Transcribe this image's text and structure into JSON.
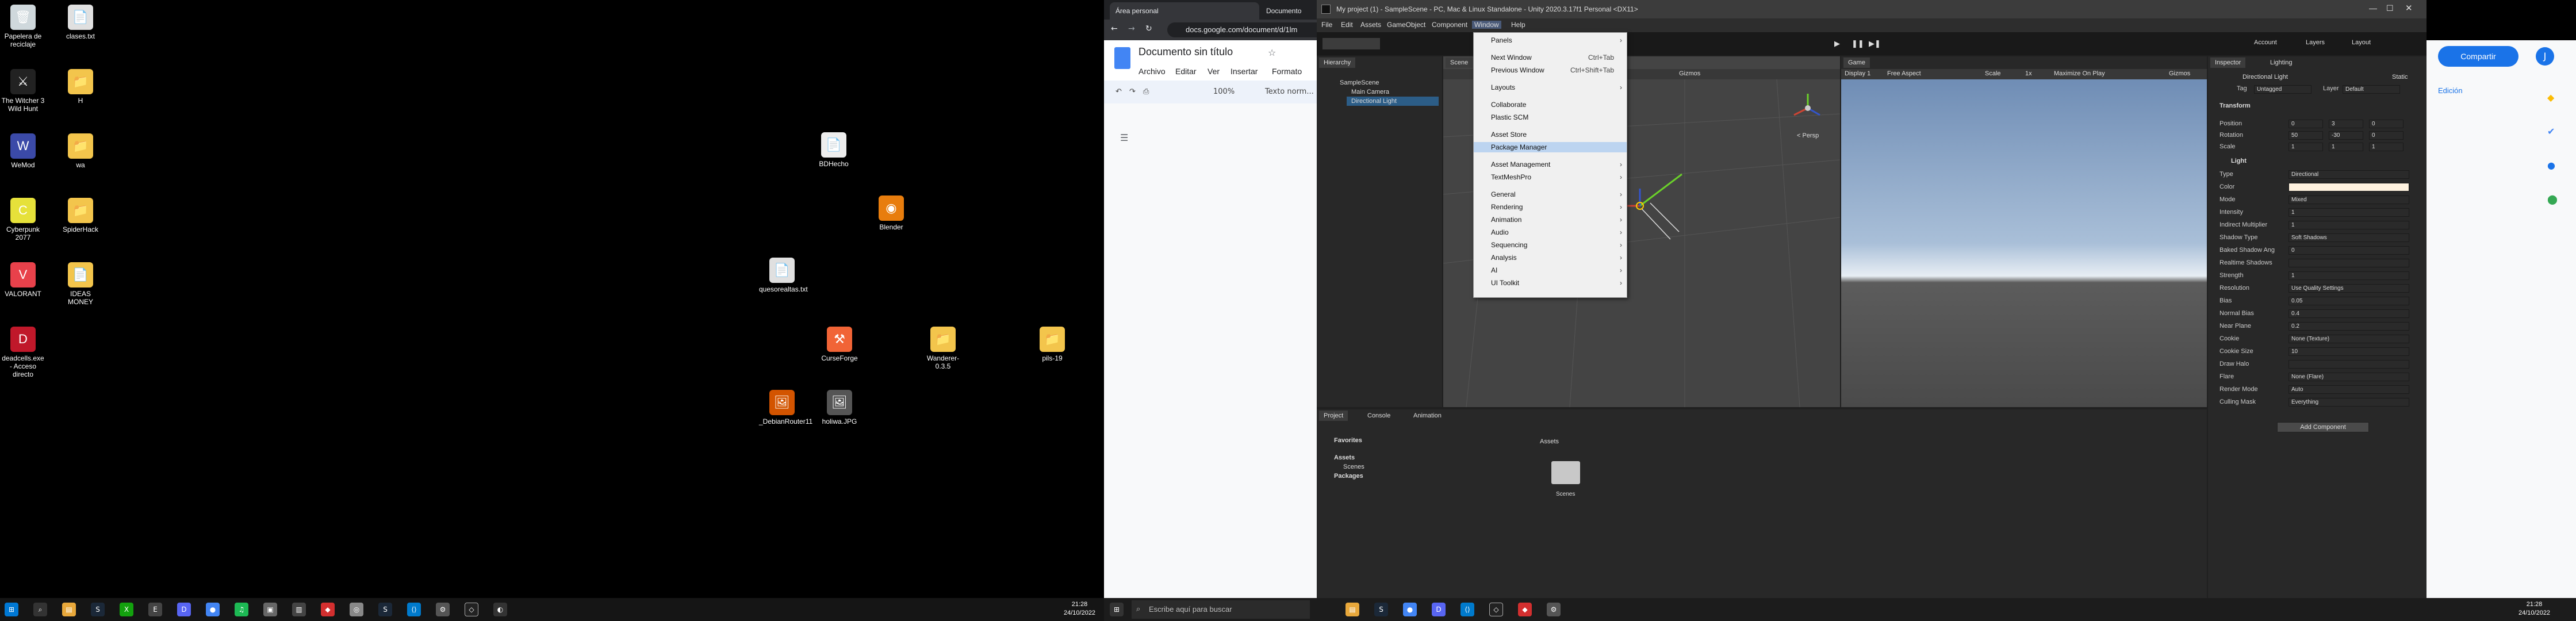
{
  "desktop": {
    "icons": [
      {
        "label": "Papelera de reciclaje",
        "icon": "recycle-bin-icon",
        "color": "#cfd8dc",
        "glyph": "🗑"
      },
      {
        "label": "clases.txt",
        "icon": "text-file-icon",
        "color": "#e0e0e0",
        "glyph": "📄"
      },
      {
        "label": "The Witcher 3 Wild Hunt",
        "icon": "witcher-icon",
        "color": "#222",
        "glyph": "⚔"
      },
      {
        "label": "H",
        "icon": "folder-icon",
        "color": "#f3c54c",
        "glyph": "📁"
      },
      {
        "label": "WeMod",
        "icon": "wemod-icon",
        "color": "#3b4aa8",
        "glyph": "W"
      },
      {
        "label": "wa",
        "icon": "folder-icon",
        "color": "#f3c54c",
        "glyph": "📁"
      },
      {
        "label": "Cyberpunk 2077",
        "icon": "cyberpunk-icon",
        "color": "#e6e13a",
        "glyph": "C"
      },
      {
        "label": "SpiderHack",
        "icon": "folder-icon",
        "color": "#f3c54c",
        "glyph": "📁"
      },
      {
        "label": "VALORANT",
        "icon": "valorant-icon",
        "color": "#e8414b",
        "glyph": "V"
      },
      {
        "label": "IDEAS MONEY",
        "icon": "text-file-icon",
        "color": "#f3c54c",
        "glyph": "📄"
      },
      {
        "label": "deadcells.exe - Acceso directo",
        "icon": "deadcells-icon",
        "color": "#c0182a",
        "glyph": "D"
      },
      {
        "label": "BDHecho",
        "icon": "document-icon",
        "color": "#eeeeee",
        "glyph": "📄"
      },
      {
        "label": "Blender",
        "icon": "blender-icon",
        "color": "#e87d0d",
        "glyph": "◉"
      },
      {
        "label": "quesorealtas.txt",
        "icon": "text-file-icon",
        "color": "#e0e0e0",
        "glyph": "📄"
      },
      {
        "label": "CurseForge",
        "icon": "curseforge-icon",
        "color": "#f16436",
        "glyph": "⚒"
      },
      {
        "label": "Wanderer-0.3.5",
        "icon": "folder-icon",
        "color": "#f3c54c",
        "glyph": "📁"
      },
      {
        "label": "pils-19",
        "icon": "folder-icon",
        "color": "#f3c54c",
        "glyph": "📁"
      },
      {
        "label": "_DebianRouter11",
        "icon": "image-icon",
        "color": "#d35400",
        "glyph": "🖼"
      },
      {
        "label": "holiwa.JPG",
        "icon": "image-icon",
        "color": "#555",
        "glyph": "🖼"
      }
    ]
  },
  "taskbar_left": {
    "time": "21:28",
    "date": "24/10/2022"
  },
  "taskbar_right": {
    "search_placeholder": "Escribe aquí para buscar",
    "time": "21:28",
    "date": "24/10/2022"
  },
  "chrome": {
    "tabs": [
      "Área personal",
      "Documento"
    ],
    "url": "docs.google.com/document/d/1lm",
    "doc_title": "Documento sin título",
    "menus": [
      "Archivo",
      "Editar",
      "Ver",
      "Insertar",
      "Formato"
    ],
    "zoom": "100%",
    "style": "Texto norm...",
    "share": "Compartir",
    "editing": "Edición",
    "avatar": "J"
  },
  "unity": {
    "title": "My project (1) - SampleScene - PC, Mac & Linux Standalone - Unity 2020.3.17f1 Personal <DX11>",
    "menus": [
      "File",
      "Edit",
      "Assets",
      "GameObject",
      "Component",
      "Window",
      "Help"
    ],
    "account": "Account",
    "layers": "Layers",
    "layout": "Layout",
    "hierarchy": {
      "tab": "Hierarchy",
      "scene": "SampleScene",
      "items": [
        "Main Camera",
        "Directional Light"
      ]
    },
    "scene_tab": "Scene",
    "game_tab": "Game",
    "display": "Display 1",
    "aspect": "Free Aspect",
    "scale_label": "Scale",
    "scale_value": "1x",
    "maximize": "Maximize On Play",
    "gizmos": "Gizmos",
    "persp": "< Persp",
    "project": {
      "tabs": [
        "Project",
        "Console",
        "Animation"
      ],
      "favorites": "Favorites",
      "assets": "Assets",
      "scenes": "Scenes",
      "packages": "Packages",
      "breadcrumb": "Assets",
      "folder": "Scenes"
    },
    "inspector": {
      "tabs": [
        "Inspector",
        "Lighting"
      ],
      "object": "Directional Light",
      "static": "Static",
      "tag": "Tag",
      "tag_value": "Untagged",
      "layer": "Layer",
      "layer_value": "Default",
      "transform": "Transform",
      "position": {
        "label": "Position",
        "x": "0",
        "y": "3",
        "z": "0"
      },
      "rotation": {
        "label": "Rotation",
        "x": "50",
        "y": "-30",
        "z": "0"
      },
      "scale": {
        "label": "Scale",
        "x": "1",
        "y": "1",
        "z": "1"
      },
      "light": "Light",
      "rows": [
        {
          "label": "Type",
          "value": "Directional"
        },
        {
          "label": "Color",
          "value": ""
        },
        {
          "label": "Mode",
          "value": "Mixed"
        },
        {
          "label": "Intensity",
          "value": "1"
        },
        {
          "label": "Indirect Multiplier",
          "value": "1"
        },
        {
          "label": "Shadow Type",
          "value": "Soft Shadows"
        },
        {
          "label": "Baked Shadow Ang",
          "value": "0"
        },
        {
          "label": "Realtime Shadows",
          "value": ""
        },
        {
          "label": "Strength",
          "value": "1"
        },
        {
          "label": "Resolution",
          "value": "Use Quality Settings"
        },
        {
          "label": "Bias",
          "value": "0.05"
        },
        {
          "label": "Normal Bias",
          "value": "0.4"
        },
        {
          "label": "Near Plane",
          "value": "0.2"
        },
        {
          "label": "Cookie",
          "value": "None (Texture)"
        },
        {
          "label": "Cookie Size",
          "value": "10"
        },
        {
          "label": "Draw Halo",
          "value": ""
        },
        {
          "label": "Flare",
          "value": "None (Flare)"
        },
        {
          "label": "Render Mode",
          "value": "Auto"
        },
        {
          "label": "Culling Mask",
          "value": "Everything"
        }
      ],
      "add_component": "Add Component"
    }
  },
  "window_menu": {
    "items": [
      {
        "label": "Panels",
        "shortcut": "",
        "arrow": "›"
      },
      {
        "label": "Next Window",
        "shortcut": "Ctrl+Tab",
        "arrow": ""
      },
      {
        "label": "Previous Window",
        "shortcut": "Ctrl+Shift+Tab",
        "arrow": ""
      },
      {
        "label": "Layouts",
        "shortcut": "",
        "arrow": "›"
      },
      {
        "label": "Collaborate",
        "shortcut": "",
        "arrow": ""
      },
      {
        "label": "Plastic SCM",
        "shortcut": "",
        "arrow": ""
      },
      {
        "label": "Asset Store",
        "shortcut": "",
        "arrow": ""
      },
      {
        "label": "Package Manager",
        "shortcut": "",
        "arrow": ""
      },
      {
        "label": "Asset Management",
        "shortcut": "",
        "arrow": "›"
      },
      {
        "label": "TextMeshPro",
        "shortcut": "",
        "arrow": "›"
      },
      {
        "label": "General",
        "shortcut": "",
        "arrow": "›"
      },
      {
        "label": "Rendering",
        "shortcut": "",
        "arrow": "›"
      },
      {
        "label": "Animation",
        "shortcut": "",
        "arrow": "›"
      },
      {
        "label": "Audio",
        "shortcut": "",
        "arrow": "›"
      },
      {
        "label": "Sequencing",
        "shortcut": "",
        "arrow": "›"
      },
      {
        "label": "Analysis",
        "shortcut": "",
        "arrow": "›"
      },
      {
        "label": "AI",
        "shortcut": "",
        "arrow": "›"
      },
      {
        "label": "UI Toolkit",
        "shortcut": "",
        "arrow": "›"
      }
    ],
    "highlighted": "Package Manager"
  }
}
